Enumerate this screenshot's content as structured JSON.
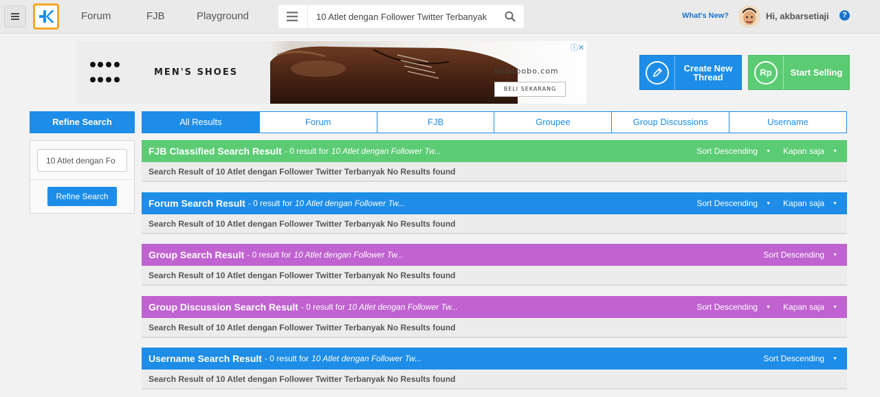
{
  "topbar": {
    "nav": [
      "Forum",
      "FJB",
      "Playground"
    ],
    "search_value": "10 Atlet dengan Follower Twitter Terbanyak",
    "whats_new": "What's New?",
    "greeting": "Hi, akbarsetiaji",
    "help": "?"
  },
  "ad": {
    "brand": "MEN'S SHOES",
    "url": "bobobobo.com",
    "cta": "BELI SEKARANG",
    "adchoice": "ⓘ✕"
  },
  "actions": {
    "create_line1": "Create New",
    "create_line2": "Thread",
    "sell": "Start Selling",
    "sell_icon": "Rp"
  },
  "sidebar": {
    "title": "Refine Search",
    "input_value": "10 Atlet dengan Fo",
    "button": "Refine Search"
  },
  "tabs": [
    "All Results",
    "Forum",
    "FJB",
    "Groupee",
    "Group Discussions",
    "Username"
  ],
  "sections": [
    {
      "title": "FJB Classified Search Result",
      "count": "- 0 result for",
      "query": "10 Atlet dengan Follower Tw...",
      "sort": "Sort Descending",
      "time": "Kapan saja",
      "body": "Search Result of 10 Atlet dengan Follower Twitter Terbanyak No Results found"
    },
    {
      "title": "Forum Search Result",
      "count": "- 0 result for",
      "query": "10 Atlet dengan Follower Tw...",
      "sort": "Sort Descending",
      "time": "Kapan saja",
      "body": "Search Result of 10 Atlet dengan Follower Twitter Terbanyak No Results found"
    },
    {
      "title": "Group Search Result",
      "count": "- 0 result for",
      "query": "10 Atlet dengan Follower Tw...",
      "sort": "Sort Descending",
      "body": "Search Result of 10 Atlet dengan Follower Twitter Terbanyak No Results found"
    },
    {
      "title": "Group Discussion Search Result",
      "count": "- 0 result for",
      "query": "10 Atlet dengan Follower Tw...",
      "sort": "Sort Descending",
      "time": "Kapan saja",
      "body": "Search Result of 10 Atlet dengan Follower Twitter Terbanyak No Results found"
    },
    {
      "title": "Username Search Result",
      "count": "- 0 result for",
      "query": "10 Atlet dengan Follower Tw...",
      "sort": "Sort Descending",
      "body": "Search Result of 10 Atlet dengan Follower Twitter Terbanyak No Results found"
    }
  ],
  "colors": {
    "accent_blue": "#1d8de8",
    "fjb_green": "#5ccc74",
    "group_purple": "#c062d0",
    "logo_orange": "#f5a623"
  },
  "icons": [
    "menu-icon",
    "kaskus-logo",
    "search-icon",
    "avatar",
    "help-icon",
    "pencil-icon",
    "rupiah-icon",
    "chevron-down-icon"
  ]
}
